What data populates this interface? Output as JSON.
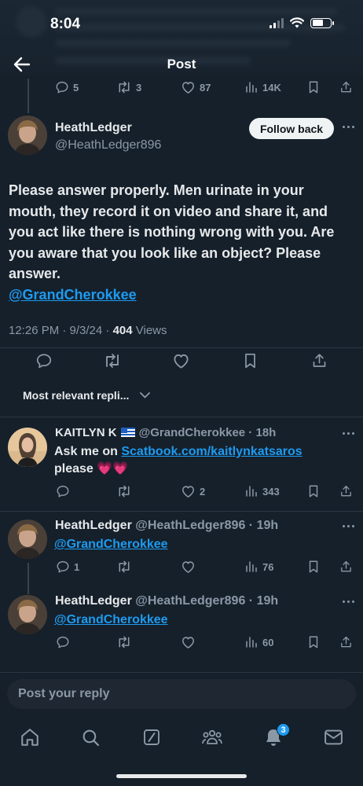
{
  "status_bar": {
    "time": "8:04"
  },
  "header": {
    "title": "Post"
  },
  "parent_actions": {
    "replies": "5",
    "reposts": "3",
    "likes": "87",
    "views": "14K"
  },
  "main_tweet": {
    "display_name": "HeathLedger",
    "handle": "@HeathLedger896",
    "follow_label": "Follow back",
    "text": "Please answer properly. Men urinate in your mouth, they record it on video and share it, and you act like there is nothing wrong with you. Are you aware that you look like an object? Please answer.",
    "mention": "@GrandCherokkee",
    "time": "12:26 PM · 9/3/24 · ",
    "views_count": "404",
    "views_label": " Views"
  },
  "sort": {
    "label": "Most relevant repli..."
  },
  "replies": [
    {
      "display_name": "KAITLYN K",
      "handle": "@GrandCherokkee",
      "age": "18h",
      "text_prefix": "Ask me on ",
      "link": "Scatbook.com/kaitlynkatsaros",
      "text_suffix": "please",
      "emoji": "💗💗",
      "actions": {
        "replies": "",
        "reposts": "",
        "likes": "2",
        "views": "343"
      }
    },
    {
      "display_name": "HeathLedger",
      "handle": "@HeathLedger896",
      "age": "19h",
      "mention": "@GrandCherokkee",
      "actions": {
        "replies": "1",
        "reposts": "",
        "likes": "",
        "views": "76"
      }
    },
    {
      "display_name": "HeathLedger",
      "handle": "@HeathLedger896",
      "age": "19h",
      "mention": "@GrandCherokkee",
      "actions": {
        "replies": "",
        "reposts": "",
        "likes": "",
        "views": "60"
      }
    }
  ],
  "reply_box": {
    "placeholder": "Post your reply"
  },
  "tabbar": {
    "notifications_badge": "3",
    "tabs": [
      "home-icon",
      "search-icon",
      "grok-icon",
      "communities-icon",
      "notifications-icon",
      "messages-icon"
    ]
  },
  "colors": {
    "background": "#15202b",
    "link": "#1d9bf0",
    "muted": "#8b98a5",
    "text": "#e7e9ea"
  }
}
